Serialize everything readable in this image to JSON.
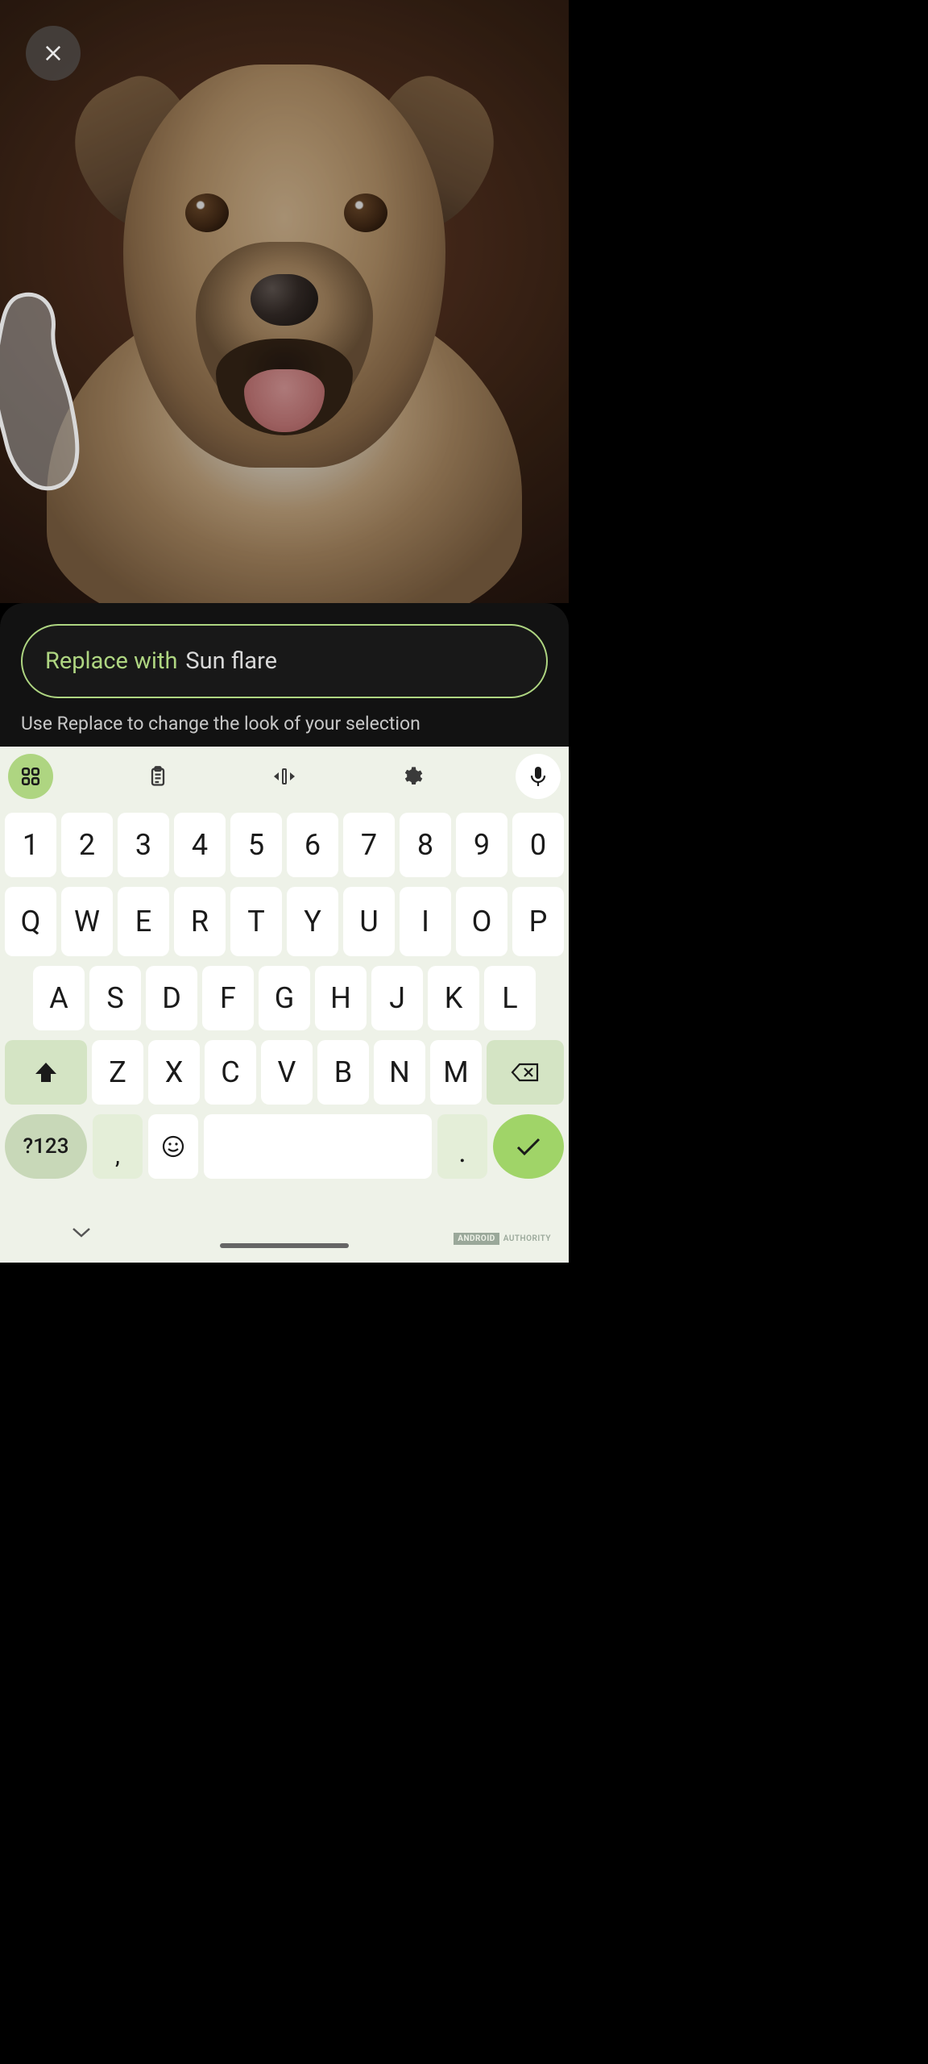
{
  "header": {
    "close_label": "Close"
  },
  "input": {
    "label": "Replace with",
    "value": "Sun flare",
    "hint": "Use Replace to change the look of your selection"
  },
  "keyboard": {
    "row_numbers": [
      "1",
      "2",
      "3",
      "4",
      "5",
      "6",
      "7",
      "8",
      "9",
      "0"
    ],
    "row_qwerty": [
      "Q",
      "W",
      "E",
      "R",
      "T",
      "Y",
      "U",
      "I",
      "O",
      "P"
    ],
    "row_asdf": [
      "A",
      "S",
      "D",
      "F",
      "G",
      "H",
      "J",
      "K",
      "L"
    ],
    "row_zxcv": [
      "Z",
      "X",
      "C",
      "V",
      "B",
      "N",
      "M"
    ],
    "sym_key": "?123",
    "comma_key": ",",
    "period_key": "."
  },
  "watermark": {
    "brand": "ANDROID",
    "suffix": "AUTHORITY"
  }
}
